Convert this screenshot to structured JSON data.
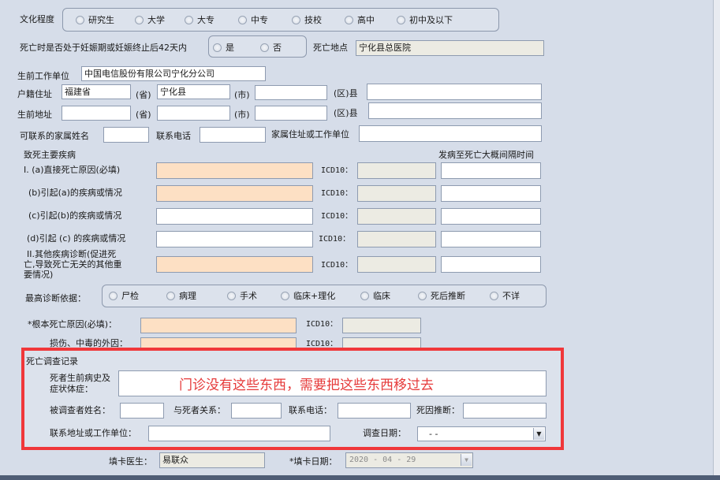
{
  "education": {
    "label": "文化程度",
    "options": [
      "研究生",
      "大学",
      "大专",
      "中专",
      "技校",
      "高中",
      "初中及以下"
    ]
  },
  "pregnancy": {
    "label": "死亡时是否处于妊娠期或妊娠终止后42天内",
    "options": [
      "是",
      "否"
    ]
  },
  "death_place": {
    "label": "死亡地点",
    "value": "宁化县总医院"
  },
  "work_unit": {
    "label": "生前工作单位",
    "value": "中国电信股份有限公司宁化分公司"
  },
  "household": {
    "label": "户籍住址",
    "province": "福建省",
    "province_unit": "(省)",
    "city": "宁化县",
    "city_unit": "(市)",
    "district_unit": "(区)县"
  },
  "address": {
    "label": "生前地址",
    "province_unit": "(省)",
    "city_unit": "(市)",
    "district_unit": "(区)县"
  },
  "contact": {
    "family_name_label": "可联系的家属姓名",
    "phone_label": "联系电话",
    "family_address_label": "家属住址或工作单位"
  },
  "disease": {
    "section_label": "致死主要疾病",
    "interval_label": "发病至死亡大概间隔时间",
    "icd_label": "ICD10：",
    "rows": [
      {
        "label": "I. (a)直接死亡原因(必填)"
      },
      {
        "label": "(b)引起(a)的疾病或情况"
      },
      {
        "label": "(c)引起(b)的疾病或情况"
      },
      {
        "label": "(d)引起 (c) 的疾病或情况"
      },
      {
        "label_lines": [
          "II.其他疾病诊断(促进死",
          "亡,导致死亡无关的其他重",
          "要情况)"
        ]
      }
    ]
  },
  "diagnosis_basis": {
    "label": "最高诊断依据：",
    "options": [
      "尸检",
      "病理",
      "手术",
      "临床+理化",
      "临床",
      "死后推断",
      "不详"
    ]
  },
  "root_cause": {
    "label": "*根本死亡原因(必填)：",
    "icd_label": "ICD10："
  },
  "injury": {
    "label": "损伤、中毒的外因：",
    "icd_label": "ICD10："
  },
  "investigation": {
    "title": "死亡调查记录",
    "history_label_lines": [
      "死者生前病史及",
      "症状体症："
    ],
    "annotation": "门诊没有这些东西，需要把这些东西移过去",
    "name_label": "被调查者姓名：",
    "relation_label": "与死者关系：",
    "phone_label": "联系电话：",
    "inference_label": "死因推断：",
    "address_label": "联系地址或工作单位：",
    "date_label": "调查日期：",
    "date_value": "-   -"
  },
  "doctor": {
    "label": "填卡医生：",
    "value": "易联众"
  },
  "card_date": {
    "label": "*填卡日期：",
    "value": "2020 - 04 - 29"
  },
  "colors": {
    "highlight": "#f0373a",
    "required_field": "#fde0c4",
    "readonly_field": "#ecebe3"
  }
}
